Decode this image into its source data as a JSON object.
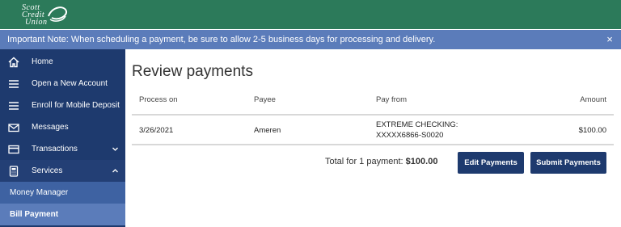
{
  "brand": {
    "logo_lines": [
      "Scott",
      "Credit",
      "Union"
    ],
    "logo_initials": [
      "S",
      "C",
      "U"
    ]
  },
  "notice": {
    "text": "Important Note: When scheduling a payment, be sure to allow 2-5 business days for processing and delivery.",
    "close": "×"
  },
  "sidebar": {
    "items": [
      {
        "label": "Home",
        "icon": "home-icon"
      },
      {
        "label": "Open a New Account",
        "icon": "menu-icon"
      },
      {
        "label": "Enroll for Mobile Deposit",
        "icon": "menu-icon"
      },
      {
        "label": "Messages",
        "icon": "envelope-icon"
      },
      {
        "label": "Transactions",
        "icon": "card-icon",
        "chevron": "down"
      },
      {
        "label": "Services",
        "icon": "calculator-icon",
        "chevron": "up"
      }
    ],
    "subitems": [
      {
        "label": "Money Manager"
      },
      {
        "label": "Bill Payment",
        "active": true
      }
    ]
  },
  "main": {
    "title": "Review payments",
    "columns": [
      "Process on",
      "Payee",
      "Pay from",
      "Amount"
    ],
    "rows": [
      {
        "process_on": "3/26/2021",
        "payee": "Ameren",
        "pay_from": "EXTREME CHECKING: XXXXX6866-S0020",
        "amount": "$100.00"
      }
    ],
    "total_label": "Total for 1 payment: ",
    "total_value": "$100.00",
    "edit_button": "Edit Payments",
    "submit_button": "Submit Payments"
  },
  "colors": {
    "header_green": "#2c7a5a",
    "notice_blue": "#5b7cba",
    "sidebar_navy": "#1e3a6e",
    "button_navy": "#1e3a6e"
  }
}
